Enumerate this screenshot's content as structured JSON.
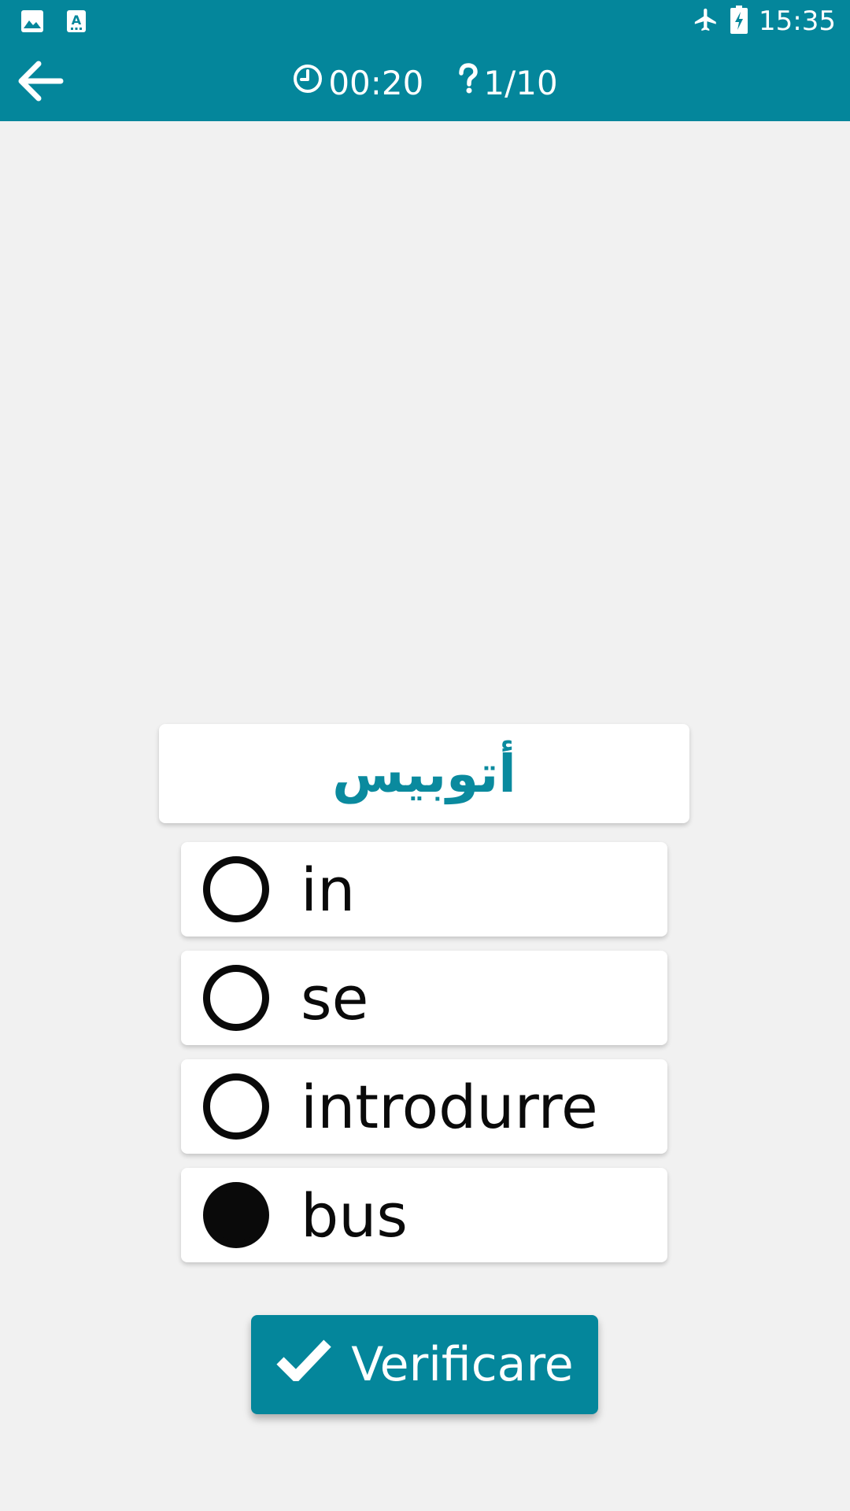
{
  "status_bar": {
    "time": "15:35",
    "icons": [
      "image-icon",
      "text-app-icon",
      "airplane-icon",
      "battery-charging-icon"
    ]
  },
  "app_bar": {
    "back_icon": "arrow-left-icon",
    "timer_icon": "clock-icon",
    "timer": "00:20",
    "question_icon": "question-mark-icon",
    "progress": "1/10"
  },
  "quiz": {
    "word": "أتوبيس",
    "options": [
      {
        "label": "in",
        "selected": false
      },
      {
        "label": "se",
        "selected": false
      },
      {
        "label": "introdurre",
        "selected": false
      },
      {
        "label": "bus",
        "selected": true
      }
    ],
    "verify_label": "Verificare",
    "verify_icon": "checkmark-icon"
  },
  "colors": {
    "primary": "#04869b",
    "word_text": "#0a8a9e",
    "background": "#f1f1f1"
  }
}
